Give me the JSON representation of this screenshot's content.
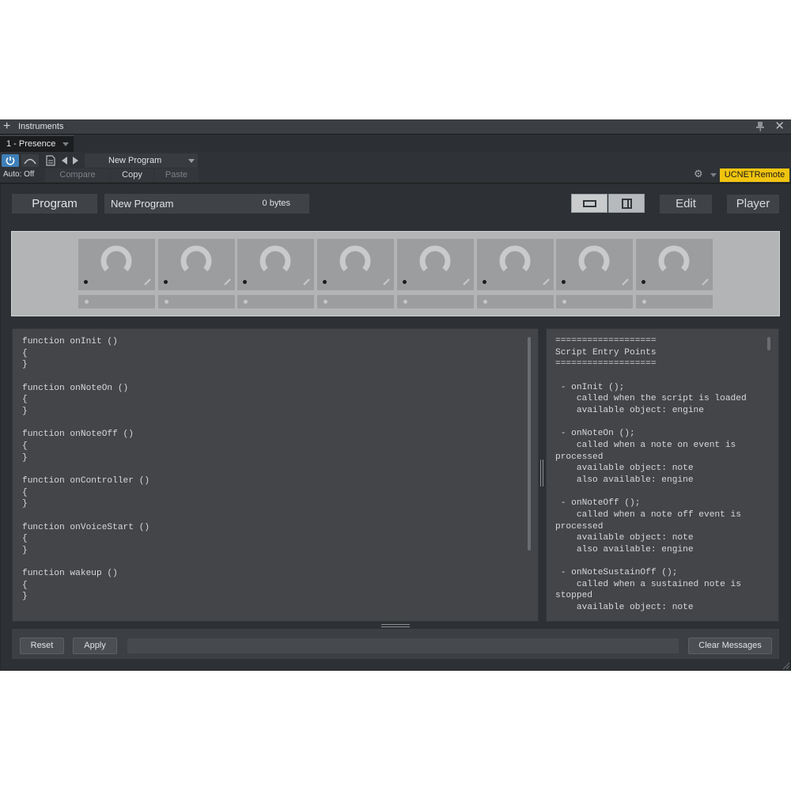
{
  "window": {
    "title": "Instruments",
    "tab": "1 - Presence"
  },
  "header": {
    "preset_name": "New Program",
    "auto_label": "Auto: Off",
    "compare_label": "Compare",
    "copy_label": "Copy",
    "paste_label": "Paste",
    "remote_label": "UCNETRemote"
  },
  "toolbar": {
    "program_label": "Program",
    "program_name": "New Program",
    "program_size": "0 bytes",
    "edit_label": "Edit",
    "player_label": "Player"
  },
  "macros": {
    "count": 8
  },
  "editor": {
    "code_lines": [
      "function onInit ()",
      "{",
      "}",
      "",
      "function onNoteOn ()",
      "{",
      "}",
      "",
      "function onNoteOff ()",
      "{",
      "}",
      "",
      "function onController ()",
      "{",
      "}",
      "",
      "function onVoiceStart ()",
      "{",
      "}",
      "",
      "function wakeup ()",
      "{",
      "}"
    ]
  },
  "help": {
    "lines": [
      "===================",
      "Script Entry Points",
      "===================",
      "",
      " - onInit ();",
      "    called when the script is loaded",
      "    available object: engine",
      "",
      " - onNoteOn ();",
      "    called when a note on event is",
      "processed",
      "    available object: note",
      "    also available: engine",
      "",
      " - onNoteOff ();",
      "    called when a note off event is",
      "processed",
      "    available object: note",
      "    also available: engine",
      "",
      " - onNoteSustainOff ();",
      "    called when a sustained note is",
      "stopped",
      "    available object: note"
    ]
  },
  "footer": {
    "reset_label": "Reset",
    "apply_label": "Apply",
    "message": "",
    "clear_label": "Clear Messages"
  },
  "icons": {
    "add": "plus-icon",
    "pin": "pin-icon",
    "close": "close-icon",
    "power": "power-icon",
    "automation": "automation-icon",
    "preset": "document-icon",
    "prev": "arrow-left-icon",
    "next": "arrow-right-icon",
    "settings": "gear-icon"
  },
  "colors": {
    "accent": "#3e7fb8",
    "remote_badge": "#f1c40f",
    "panel": "#2d3034",
    "editor_bg": "#434548"
  }
}
